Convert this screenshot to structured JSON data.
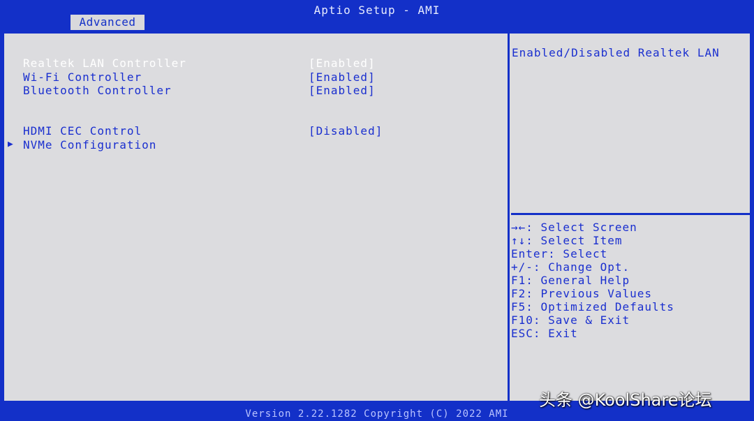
{
  "header": {
    "title": "Aptio Setup - AMI",
    "active_tab": "Advanced"
  },
  "settings": [
    {
      "label": "Realtek LAN Controller",
      "value": "[Enabled]",
      "selected": true
    },
    {
      "label": "Wi-Fi Controller",
      "value": "[Enabled]",
      "selected": false
    },
    {
      "label": "Bluetooth Controller",
      "value": "[Enabled]",
      "selected": false
    },
    {
      "label": "HDMI CEC Control",
      "value": "[Disabled]",
      "selected": false
    },
    {
      "label": "NVMe Configuration",
      "value": "",
      "selected": false,
      "submenu": true
    }
  ],
  "help": {
    "description": "Enabled/Disabled Realtek LAN"
  },
  "key_legend": [
    "→←: Select Screen",
    "↑↓: Select Item",
    "Enter: Select",
    "+/-: Change Opt.",
    "F1: General Help",
    "F2: Previous Values",
    "F5: Optimized Defaults",
    "F10: Save & Exit",
    "ESC: Exit"
  ],
  "footer": {
    "version": "Version 2.22.1282 Copyright (C) 2022 AMI"
  },
  "watermark": "头条 @KoolShare论坛",
  "colors": {
    "frame_blue": "#1330c8",
    "panel_gray": "#dcdcdf",
    "text_blue": "#1a2fcf",
    "highlight": "#ffffff"
  },
  "icons": {
    "submenu": "triangle-right"
  }
}
